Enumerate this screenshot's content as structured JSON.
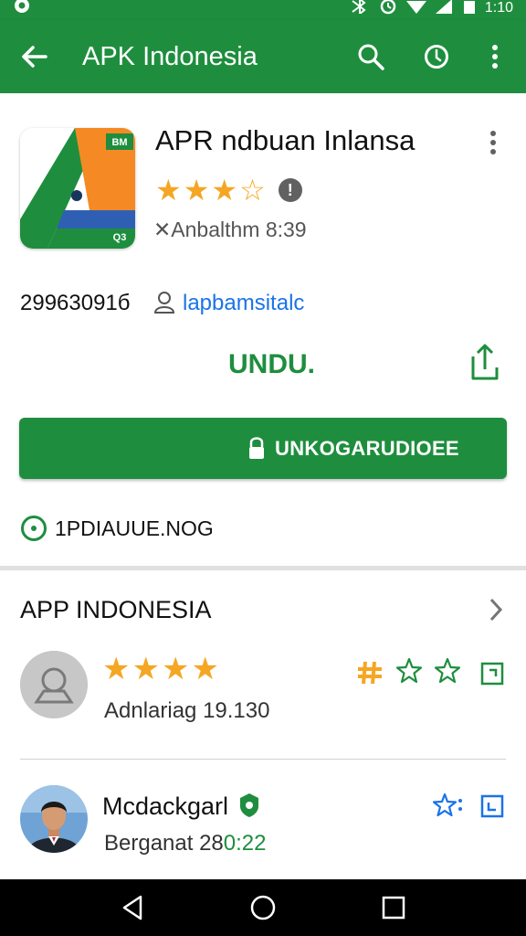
{
  "status_bar": {
    "time": "1:10"
  },
  "app_bar": {
    "title": "APK Indonesia"
  },
  "app": {
    "title": "APR ndbuan Inlansa",
    "rating_stars": 3.5,
    "meta": "Anbalthm 8:39",
    "download_count": "29963091б",
    "developer": "lapbamsitalc",
    "install_link": "UNDU.",
    "primary_button": "UNKOGARUDIOEE",
    "version_text": "1PDIAUUE.NOG",
    "icon_badge_top": "BM",
    "icon_badge_bottom": "Q3"
  },
  "section": {
    "title": "APP INDONESIA"
  },
  "reviews": [
    {
      "name": "",
      "stars": 3.5,
      "subtitle": "Adnlariag 19.130"
    },
    {
      "name": "Mcdackgarl",
      "subtitle_prefix": "Berganat 28",
      "subtitle_time": "0:22"
    }
  ],
  "colors": {
    "primary": "#1e8e3e",
    "star": "#f5a623",
    "link": "#1a73e8"
  }
}
